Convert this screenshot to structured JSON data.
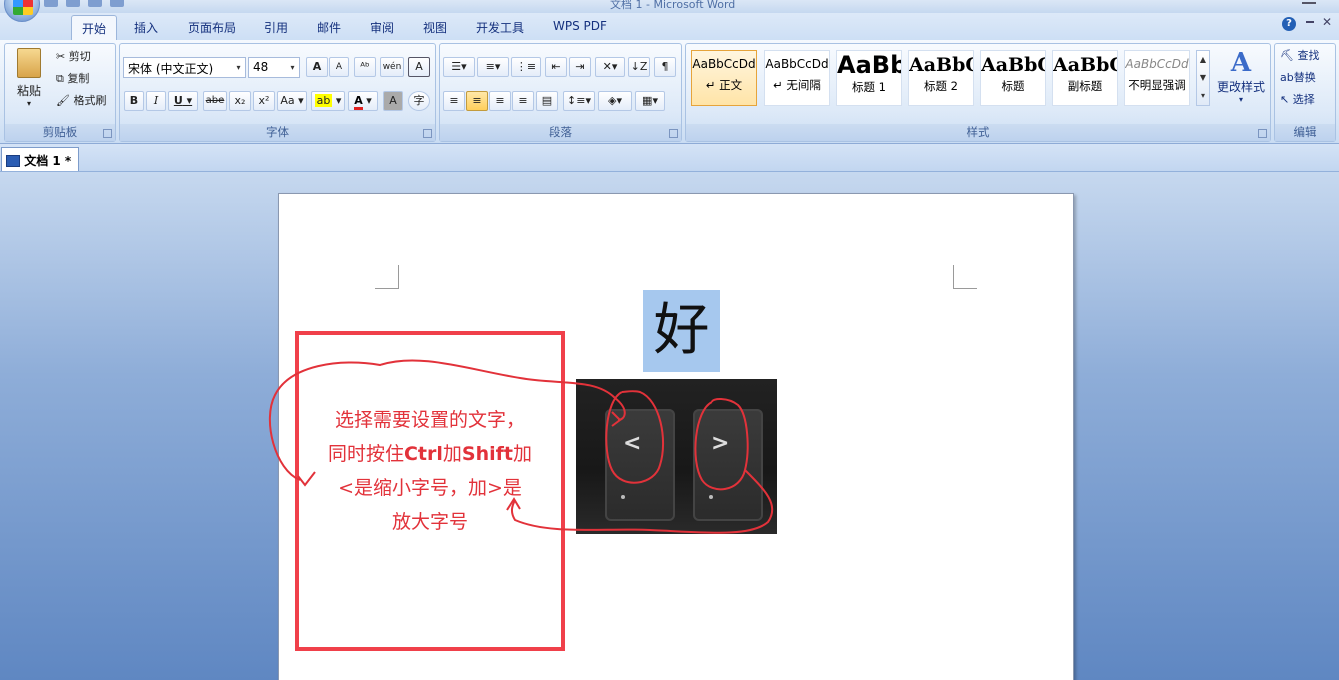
{
  "window": {
    "title": "文档 1 - Microsoft Word"
  },
  "tabs": [
    "开始",
    "插入",
    "页面布局",
    "引用",
    "邮件",
    "审阅",
    "视图",
    "开发工具",
    "WPS PDF"
  ],
  "clipboard": {
    "paste": "粘贴",
    "cut": "剪切",
    "copy": "复制",
    "format_painter": "格式刷",
    "label": "剪贴板"
  },
  "font": {
    "name": "宋体 (中文正文)",
    "size": "48",
    "label": "字体",
    "bold": "B",
    "italic": "I",
    "underline": "U",
    "strike": "abe",
    "sub": "x₂",
    "sup": "x²",
    "case": "Aa",
    "grow": "A",
    "shrink": "A",
    "phonetic": "wén",
    "border": "A",
    "shade": "A",
    "enclose": "字"
  },
  "paragraph": {
    "label": "段落"
  },
  "styles": {
    "label": "样式",
    "change": "更改样式",
    "items": [
      {
        "sample": "AaBbCcDd",
        "name": "↵ 正文"
      },
      {
        "sample": "AaBbCcDd",
        "name": "↵ 无间隔"
      },
      {
        "sample": "AaBb",
        "name": "标题 1"
      },
      {
        "sample": "AaBbC",
        "name": "标题 2"
      },
      {
        "sample": "AaBbC",
        "name": "标题"
      },
      {
        "sample": "AaBbC",
        "name": "副标题"
      },
      {
        "sample": "AaBbCcDd",
        "name": "不明显强调"
      }
    ]
  },
  "editing": {
    "find": "查找",
    "replace": "替换",
    "select": "选择",
    "label": "编辑"
  },
  "document": {
    "tab": "文档 1 *",
    "selected_char": "好"
  },
  "annotation": {
    "line1": "选择需要设置的文字，",
    "line2_a": "同时按住",
    "line2_b": "Ctrl",
    "line2_c": "加",
    "line2_d": "Shift",
    "line2_e": "加",
    "line3_a": "<",
    "line3_b": "是缩小字号，加",
    "line3_c": ">",
    "line3_d": "是",
    "line4": "放大字号"
  },
  "keys": {
    "left": "<",
    "right": ">"
  },
  "colors": {
    "accent": "#15317e",
    "annotation_red": "#e2323a",
    "highlight": "#a6c8ee"
  }
}
